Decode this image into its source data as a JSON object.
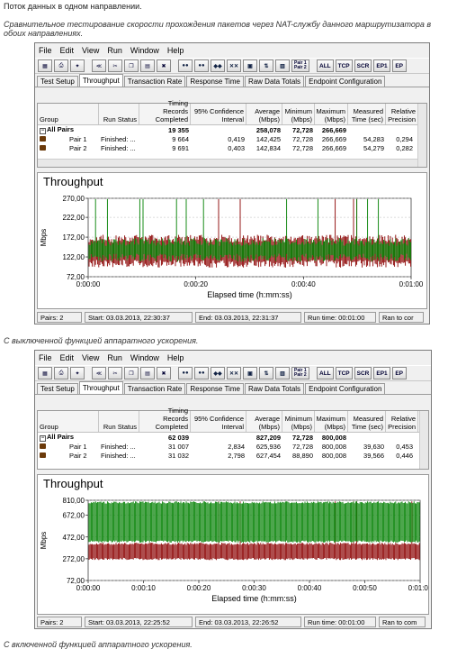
{
  "doc": {
    "line1": "Поток данных в одном направлении.",
    "line2": "Сравнительное тестирование скорости прохождения пакетов через NAT-службу данного маршрутизатора в",
    "line3": "обоих направлениях.",
    "caption1": "С выключенной функцией аппаратного ускорения.",
    "caption2": "С включенной функцией аппаратного ускорения."
  },
  "menu": [
    "File",
    "Edit",
    "View",
    "Run",
    "Window",
    "Help"
  ],
  "toolbar": {
    "pair_icon": "Pair 1 Pair 2",
    "buttons": [
      "ALL",
      "TCP",
      "SCR",
      "EP1",
      "EP"
    ]
  },
  "tabs": [
    "Test Setup",
    "Throughput",
    "Transaction Rate",
    "Response Time",
    "Raw Data Totals",
    "Endpoint Configuration"
  ],
  "columns": {
    "group": "Group",
    "run_status": "Run Status",
    "timing": [
      "Timing Records",
      "Completed"
    ],
    "confidence": [
      "95% Confidence",
      "Interval"
    ],
    "average": [
      "Average",
      "(Mbps)"
    ],
    "minimum": [
      "Minimum",
      "(Mbps)"
    ],
    "maximum": [
      "Maximum",
      "(Mbps)"
    ],
    "measured": [
      "Measured",
      "Time (sec)"
    ],
    "relative": [
      "Relative",
      "Precision"
    ]
  },
  "windows": [
    {
      "summary": {
        "label": "All Pairs",
        "timing": "19 355",
        "average": "258,078",
        "minimum": "72,728",
        "maximum": "266,669"
      },
      "rows": [
        {
          "group": "Pair 1",
          "status": "Finished: ...",
          "timing": "9 664",
          "confidence": "0,419",
          "average": "142,425",
          "minimum": "72,728",
          "maximum": "266,669",
          "measured": "54,283",
          "relative": "0,294"
        },
        {
          "group": "Pair 2",
          "status": "Finished: ...",
          "timing": "9 691",
          "confidence": "0,403",
          "average": "142,834",
          "minimum": "72,728",
          "maximum": "266,669",
          "measured": "54,279",
          "relative": "0,282"
        }
      ],
      "chart_title": "Throughput",
      "status": {
        "pairs": "Pairs: 2",
        "start": "Start: 03.03.2013, 22:30:37",
        "end": "End: 03.03.2013, 22:31:37",
        "run_time": "Run time: 00:01:00",
        "ran_to": "Ran to cor"
      }
    },
    {
      "summary": {
        "label": "All Pairs",
        "timing": "62 039",
        "average": "827,209",
        "minimum": "72,728",
        "maximum": "800,008"
      },
      "rows": [
        {
          "group": "Pair 1",
          "status": "Finished: ...",
          "timing": "31 007",
          "confidence": "2,834",
          "average": "625,936",
          "minimum": "72,728",
          "maximum": "800,008",
          "measured": "39,630",
          "relative": "0,453"
        },
        {
          "group": "Pair 2",
          "status": "Finished: ...",
          "timing": "31 032",
          "confidence": "2,798",
          "average": "627,454",
          "minimum": "88,890",
          "maximum": "800,008",
          "measured": "39,566",
          "relative": "0,446"
        }
      ],
      "chart_title": "Throughput",
      "status": {
        "pairs": "Pairs: 2",
        "start": "Start: 03.03.2013, 22:25:52",
        "end": "End: 03.03.2013, 22:26:52",
        "run_time": "Run time: 00:01:00",
        "ran_to": "Ran to com"
      }
    }
  ],
  "chart_data": [
    {
      "type": "line",
      "title": "Throughput",
      "xlabel": "Elapsed time (h:mm:ss)",
      "ylabel": "Mbps",
      "yticks": [
        "270,00",
        "222,00",
        "172,00",
        "122,00",
        "72,00"
      ],
      "ylim": [
        72,
        270
      ],
      "xticks": [
        "0:00:00",
        "0:00:20",
        "0:00:40",
        "0:01:00"
      ],
      "series": [
        {
          "color": "#8b0000",
          "band": [
            95,
            178
          ],
          "spike_max": 268
        },
        {
          "color": "#008000",
          "band": [
            110,
            170
          ],
          "spike_max": 268
        }
      ]
    },
    {
      "type": "line",
      "title": "Throughput",
      "xlabel": "Elapsed time (h:mm:ss)",
      "ylabel": "Mbps",
      "yticks": [
        "810,00",
        "672,00",
        "472,00",
        "272,00",
        "72,00"
      ],
      "ylim": [
        72,
        810
      ],
      "xticks": [
        "0:00:00",
        "0:00:10",
        "0:00:20",
        "0:00:30",
        "0:00:40",
        "0:00:50",
        "0:01:00"
      ],
      "series": [
        {
          "color": "#8b0000",
          "band": [
            260,
            420
          ],
          "spike_max": 800
        },
        {
          "color": "#008000",
          "band": [
            420,
            800
          ],
          "spike_max": 800
        }
      ]
    }
  ]
}
